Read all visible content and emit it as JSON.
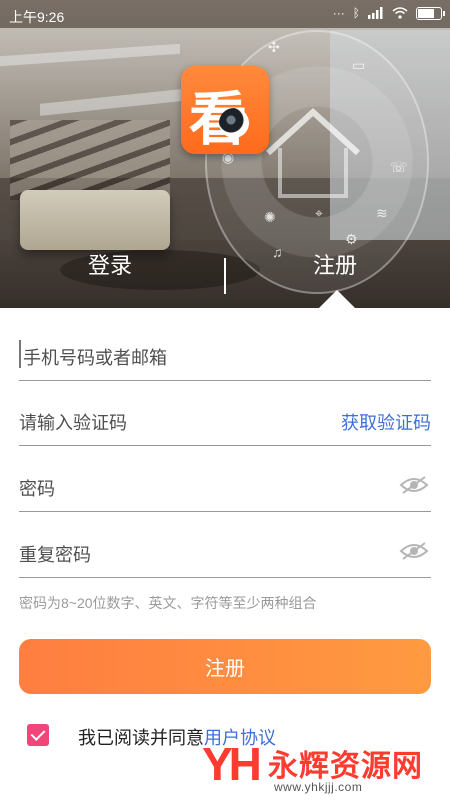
{
  "status_bar": {
    "time": "上午9:26"
  },
  "hero": {
    "logo_char": "看"
  },
  "tabs": {
    "login": "登录",
    "register": "注册"
  },
  "form": {
    "phone_email_placeholder": "手机号码或者邮箱",
    "code_placeholder": "请输入验证码",
    "get_code_label": "获取验证码",
    "password_placeholder": "密码",
    "confirm_password_placeholder": "重复密码",
    "password_hint": "密码为8~20位数字、英文、字符等至少两种组合",
    "submit_label": "注册"
  },
  "agreement": {
    "checked": true,
    "text": "我已阅读并同意",
    "link": "用户协议"
  },
  "watermark": {
    "logo_text": "YH",
    "title": "永辉资源网",
    "url": "www.yhkjjj.com"
  },
  "colors": {
    "accent_orange": "#ff8a3d",
    "link_blue": "#3f6fd8",
    "checkbox_pink": "#f0467a"
  }
}
